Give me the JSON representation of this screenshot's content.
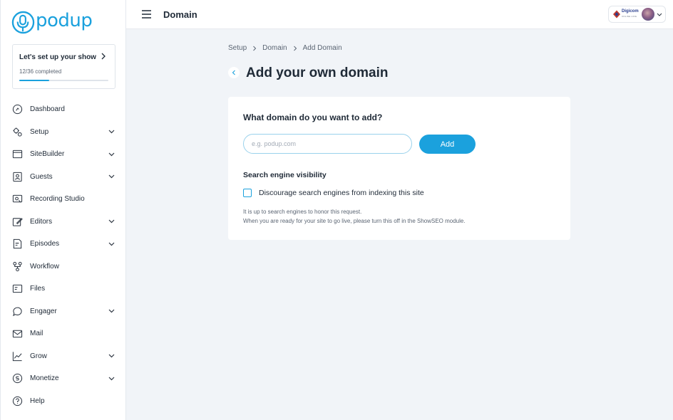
{
  "brand": {
    "logo_text": "podup",
    "accent": "#1ba1dd"
  },
  "setup_card": {
    "title": "Let's set up your show",
    "progress_text": "12/36 completed",
    "progress": 0.333
  },
  "sidebar": {
    "items": [
      {
        "label": "Dashboard",
        "icon": "dashboard-icon",
        "has_submenu": false
      },
      {
        "label": "Setup",
        "icon": "setup-gears-icon",
        "has_submenu": true
      },
      {
        "label": "SiteBuilder",
        "icon": "browser-window-icon",
        "has_submenu": true
      },
      {
        "label": "Guests",
        "icon": "guest-contact-icon",
        "has_submenu": true
      },
      {
        "label": "Recording Studio",
        "icon": "recording-studio-icon",
        "has_submenu": false
      },
      {
        "label": "Editors",
        "icon": "editor-pencil-icon",
        "has_submenu": true
      },
      {
        "label": "Episodes",
        "icon": "episodes-document-icon",
        "has_submenu": true
      },
      {
        "label": "Workflow",
        "icon": "workflow-icon",
        "has_submenu": false
      },
      {
        "label": "Files",
        "icon": "files-icon",
        "has_submenu": false
      },
      {
        "label": "Engager",
        "icon": "engager-chat-icon",
        "has_submenu": true
      },
      {
        "label": "Mail",
        "icon": "mail-icon",
        "has_submenu": false
      },
      {
        "label": "Grow",
        "icon": "grow-chart-icon",
        "has_submenu": true
      },
      {
        "label": "Monetize",
        "icon": "monetize-icon",
        "has_submenu": true
      },
      {
        "label": "Help",
        "icon": "help-icon",
        "has_submenu": false
      }
    ]
  },
  "header": {
    "title": "Domain",
    "account": {
      "company_name": "Digicom",
      "company_sub": "ONLINE HIVE"
    }
  },
  "breadcrumb": [
    "Setup",
    "Domain",
    "Add Domain"
  ],
  "page": {
    "title": "Add your own domain",
    "question": "What domain do you want to add?",
    "input_placeholder": "e.g. podup.com",
    "input_value": "",
    "add_label": "Add",
    "visibility_title": "Search engine visibility",
    "checkbox_label": "Discourage search engines from indexing this site",
    "checkbox_checked": false,
    "help_line1": "It is up to search engines to honor this request.",
    "help_line2": "When you are ready for your site to go live, please turn this off in the ShowSEO module."
  }
}
